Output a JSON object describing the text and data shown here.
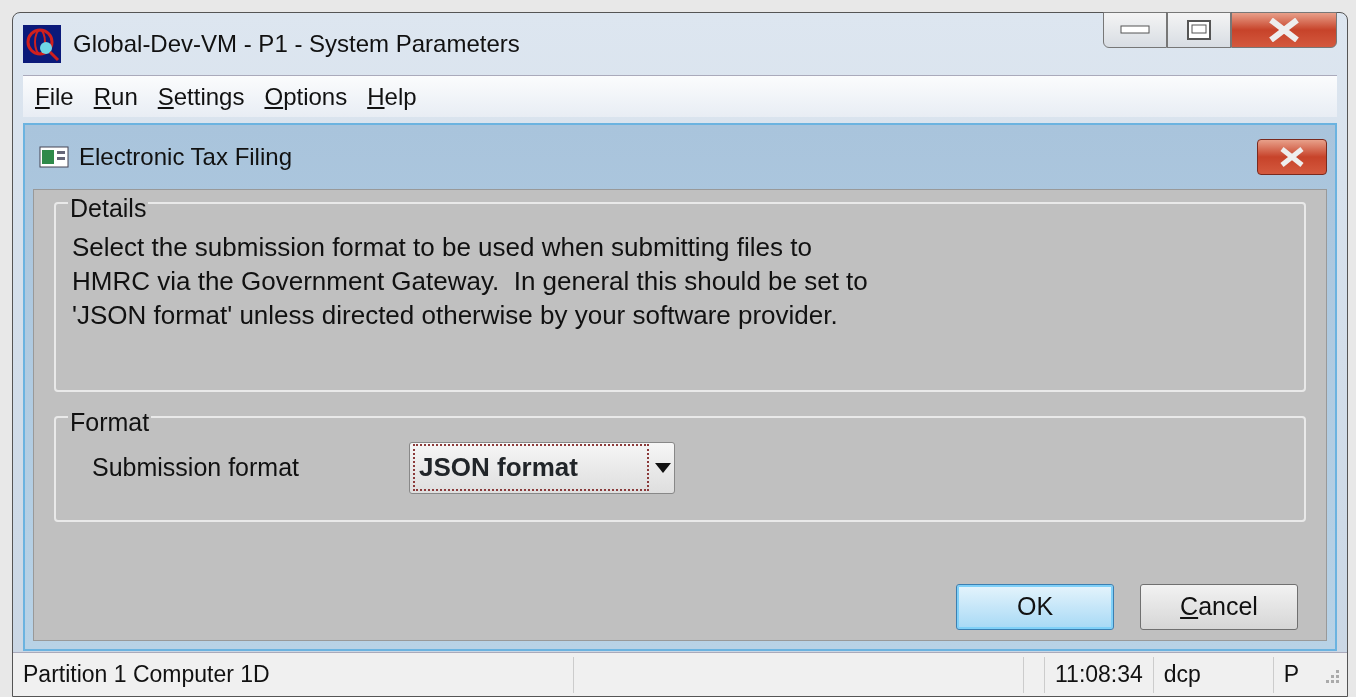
{
  "window": {
    "title": "Global-Dev-VM - P1 - System Parameters"
  },
  "menu": [
    {
      "label": "File"
    },
    {
      "label": "Run"
    },
    {
      "label": "Settings"
    },
    {
      "label": "Options"
    },
    {
      "label": "Help"
    }
  ],
  "dialog": {
    "title": "Electronic Tax Filing",
    "details": {
      "legend": "Details",
      "text": "Select the submission format to be used when submitting files to HMRC via the Government Gateway.  In general this should be set to 'JSON format' unless directed otherwise by your software provider."
    },
    "format": {
      "legend": "Format",
      "label": "Submission format",
      "value": "JSON format"
    },
    "buttons": [
      {
        "label": "OK",
        "default": true,
        "mnemonic": false
      },
      {
        "label": "Cancel",
        "default": false,
        "mnemonic": true
      }
    ]
  },
  "status_bar": [
    "Partition 1 Computer 1D",
    "11:08:34",
    "dcp",
    "P"
  ]
}
